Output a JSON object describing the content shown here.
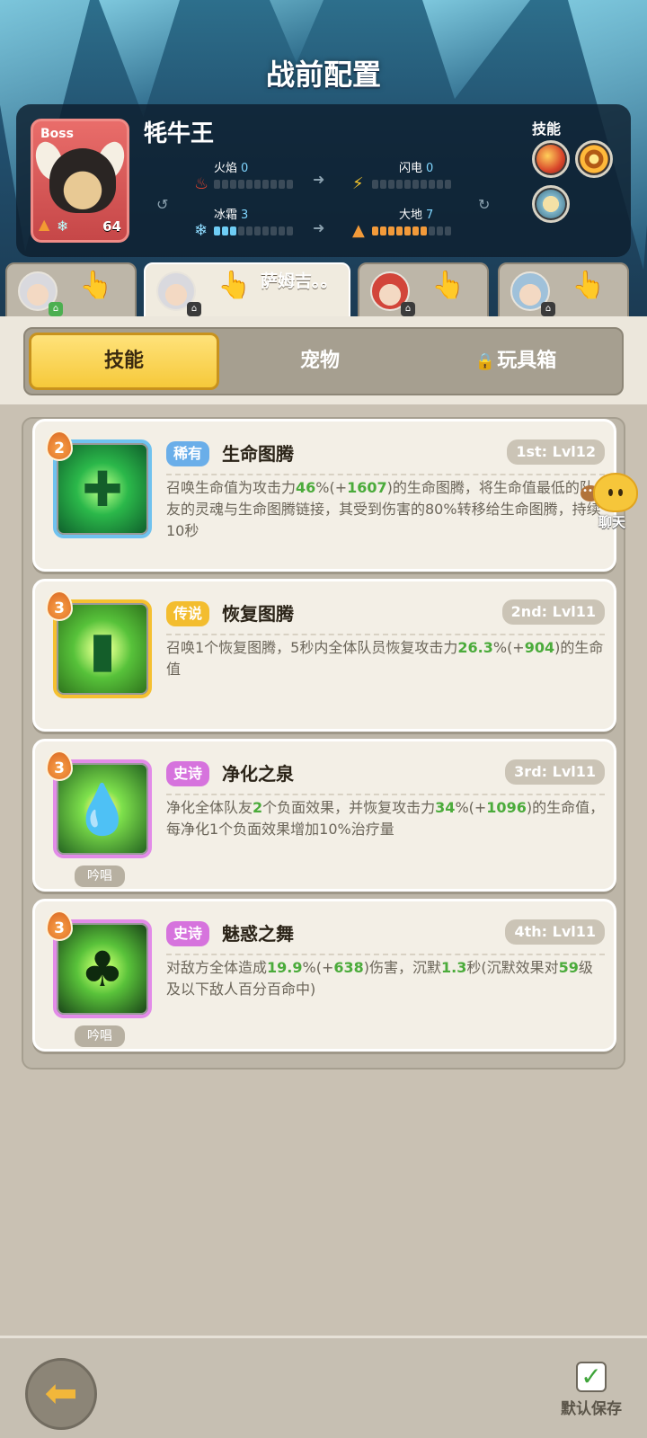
{
  "header": {
    "title": "战前配置"
  },
  "boss": {
    "tag": "Boss",
    "name": "牦牛王",
    "level": "64",
    "stats": {
      "fire": {
        "label": "火焰",
        "value": "0"
      },
      "lightning": {
        "label": "闪电",
        "value": "0"
      },
      "frost": {
        "label": "冰霜",
        "value": "3"
      },
      "earth": {
        "label": "大地",
        "value": "7"
      }
    },
    "skills_label": "技能"
  },
  "hero_tabs": [
    {
      "name": "",
      "active": false
    },
    {
      "name": "萨姆吉。。",
      "active": true
    },
    {
      "name": "",
      "active": false
    },
    {
      "name": "",
      "active": false
    }
  ],
  "segments": {
    "skills": "技能",
    "pets": "宠物",
    "toybox": "玩具箱",
    "active": "skills"
  },
  "skills": [
    {
      "tier": "2",
      "rarity": "稀有",
      "name": "生命图腾",
      "order": "1st: Lvl12",
      "desc_parts": [
        "召唤生命值为攻击力",
        "46",
        "%(+",
        "1607",
        ")的生命图腾，将生命值最低的队友的灵魂与生命图腾链接，其受到伤害的80%转移给生命图腾，持续10秒"
      ],
      "chant": ""
    },
    {
      "tier": "3",
      "rarity": "传说",
      "name": "恢复图腾",
      "order": "2nd: Lvl11",
      "desc_parts": [
        "召唤1个恢复图腾，5秒内全体队员恢复攻击力",
        "26.3",
        "%(+",
        "904",
        ")的生命值"
      ],
      "chant": ""
    },
    {
      "tier": "3",
      "rarity": "史诗",
      "name": "净化之泉",
      "order": "3rd: Lvl11",
      "desc_parts": [
        "净化全体队友",
        "2",
        "个负面效果，并恢复攻击力",
        "34",
        "%(+",
        "1096",
        ")的生命值，每净化1个负面效果增加10%治疗量"
      ],
      "chant": "吟唱"
    },
    {
      "tier": "3",
      "rarity": "史诗",
      "name": "魅惑之舞",
      "order": "4th: Lvl11",
      "desc_parts": [
        "对敌方全体造成",
        "19.9",
        "%(+",
        "638",
        ")伤害，沉默",
        "1.3",
        "秒(沉默效果对",
        "59",
        "级及以下敌人百分百命中)"
      ],
      "chant": "吟唱"
    }
  ],
  "chat": {
    "label": "聊天"
  },
  "footer": {
    "save_label": "默认保存"
  },
  "icons": {
    "fire": "fire-icon",
    "lightning": "lightning-icon",
    "frost": "snowflake-icon",
    "earth": "mountain-icon",
    "back": "back-arrow-icon",
    "save": "checkbox-checked-icon"
  }
}
